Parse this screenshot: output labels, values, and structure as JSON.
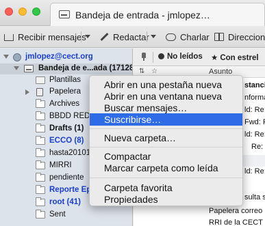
{
  "window": {
    "tab_title": "Bandeja de entrada - jmlopez…"
  },
  "toolbar": {
    "get_messages": "Recibir mensajes",
    "compose": "Redactar",
    "chat": "Charlar",
    "address_book": "Direccione"
  },
  "folders": {
    "account": "jmlopez@cect.org",
    "inbox": "Bandeja de e...ada (17128)",
    "items": [
      {
        "label": "Plantillas",
        "style": "normal"
      },
      {
        "label": "Papelera",
        "style": "normal"
      },
      {
        "label": "Archives",
        "style": "normal"
      },
      {
        "label": "BBDD REDE",
        "style": "normal"
      },
      {
        "label": "Drafts (1)",
        "style": "bold"
      },
      {
        "label": "ECCO (8)",
        "style": "blue"
      },
      {
        "label": "hasta201012",
        "style": "normal"
      },
      {
        "label": "MIRRI",
        "style": "normal"
      },
      {
        "label": "pendiente",
        "style": "normal"
      },
      {
        "label": "Reporte Ep",
        "style": "blue"
      },
      {
        "label": "root (41)",
        "style": "blue"
      },
      {
        "label": "Sent",
        "style": "normal"
      }
    ]
  },
  "messages": {
    "filters": {
      "unread": "No leídos",
      "starred": "Con estrel"
    },
    "column_subject": "Asunto",
    "rows": [
      {
        "text": "stancia",
        "bold": true
      },
      {
        "text": "nforma",
        "bold": false
      },
      {
        "text": "ld: Re:",
        "bold": false
      },
      {
        "text": "Fwd: Re:",
        "bold": false
      },
      {
        "text": "ld: Re: I",
        "bold": false
      },
      {
        "text": "Re: I",
        "bold": false
      },
      {
        "text": "",
        "bold": false
      },
      {
        "text": "ld: Re: [S",
        "bold": false
      },
      {
        "text": "",
        "bold": false
      },
      {
        "text": "",
        "bold": false
      },
      {
        "text": "sulta s",
        "bold": false
      },
      {
        "text": "Papelera correo",
        "bold": false
      },
      {
        "text": "RRI de la CECT",
        "bold": false
      }
    ]
  },
  "context_menu": {
    "items": [
      "Abrir en una pestaña nueva",
      "Abrir en una ventana nueva",
      "Buscar mensajes…",
      "Suscribirse…",
      "Nueva carpeta…",
      "Compactar",
      "Marcar carpeta como leída",
      "Carpeta favorita",
      "Propiedades"
    ],
    "highlighted_index": 3
  }
}
